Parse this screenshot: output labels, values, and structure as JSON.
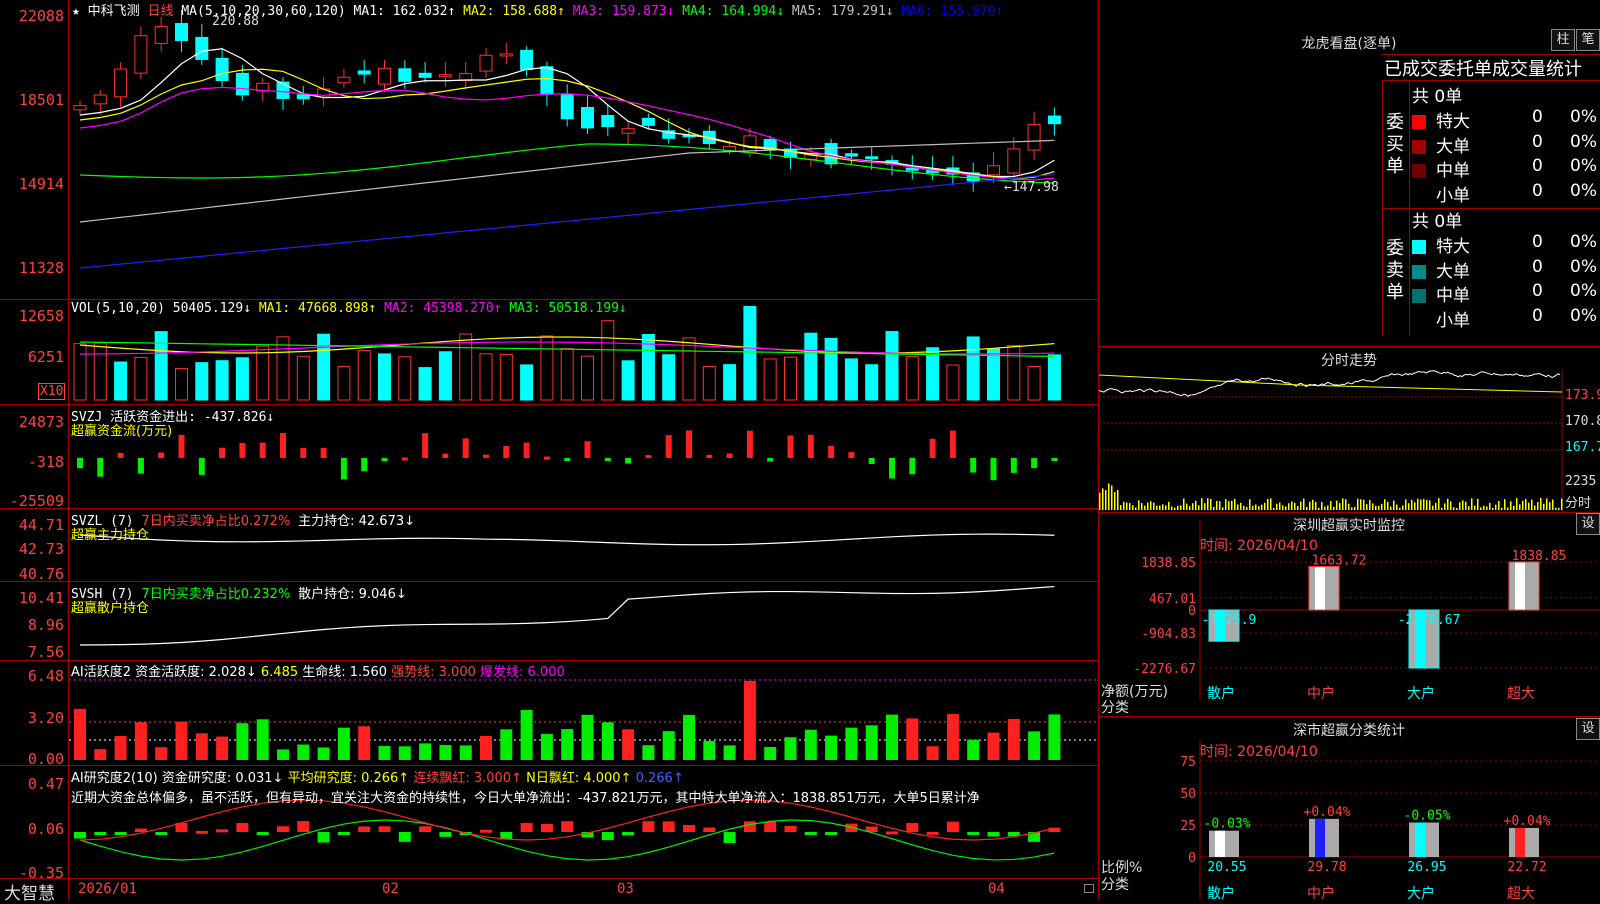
{
  "stock": {
    "star": "★",
    "name": "中科飞测",
    "period": "日线"
  },
  "main_chart": {
    "ma_params": "MA(5,10,20,30,60,120)",
    "ma_items": [
      {
        "text": "MA1: 162.032↑",
        "color": "#ffffff"
      },
      {
        "text": "MA2: 158.688↑",
        "color": "#ffff00"
      },
      {
        "text": "MA3: 159.873↓",
        "color": "#ff00ff"
      },
      {
        "text": "MA4: 164.994↓",
        "color": "#00ff00"
      },
      {
        "text": "MA5: 179.291↓",
        "color": "#c0c0c0"
      },
      {
        "text": "MA6: 155.970↑",
        "color": "#0000ff"
      }
    ],
    "y_labels": [
      "22088",
      "18501",
      "14914",
      "11328"
    ],
    "high_marker": "220.88",
    "low_marker": "←147.98"
  },
  "vol": {
    "title": "VOL(5,10,20)",
    "value": "50405.129↓",
    "ma1": "MA1: 47668.898↑",
    "ma2": "MA2: 45398.270↑",
    "ma3": "MA3: 50518.199↓",
    "y_labels": [
      "12658",
      "6251"
    ],
    "unit": "X10"
  },
  "svzj": {
    "title": "SVZJ  活跃资金进出: -437.826↓",
    "subtitle": "超赢资金流(万元)",
    "y_labels": [
      "24873",
      "-318",
      "-25509"
    ]
  },
  "svzl": {
    "title": "SVZL (7)",
    "ratio": "7日内买卖净占比0.272%",
    "hold": "主力持仓: 42.673↓",
    "subtitle": "超赢主力持仓",
    "y_labels": [
      "44.71",
      "42.73",
      "40.76"
    ]
  },
  "svsh": {
    "title": "SVSH (7)",
    "ratio": "7日内买卖净占比0.232%",
    "hold": "散户持仓: 9.046↓",
    "subtitle": "超赢散户持仓",
    "y_labels": [
      "10.41",
      "8.96",
      "7.56"
    ]
  },
  "ai_active": {
    "title": "AI活跃度2 资金活跃度: 2.028↓",
    "v2": "6.485",
    "life": "生命线: 1.560",
    "strong": "强势线: 3.000",
    "burst": "爆发线: 6.000",
    "y_labels": [
      "6.48",
      "3.20",
      "0.00"
    ]
  },
  "ai_research": {
    "title": "AI研究度2(10) 资金研究度: 0.031↓",
    "avg": "平均研究度: 0.266↑",
    "cont": "连续飘红: 3.000↑",
    "nday": "N日飘红: 4.000↑",
    "last": "0.266↑",
    "comment": "近期大资金总体偏多，虽不活跃，但有异动，宜关注大资金的持续性，今日大单净流出：-437.821万元，其中特大单净流入：1838.851万元，大单5日累计净",
    "y_labels": [
      "0.47",
      "0.06",
      "-0.35"
    ]
  },
  "footer": {
    "brand": "大智慧",
    "dates": [
      "2026/01",
      "02",
      "03",
      "04"
    ]
  },
  "dragon": {
    "title": "龙虎看盘(逐单)",
    "btn_bar": "柱",
    "btn_pen": "笔",
    "tabs": [
      "已成交委托单",
      "成交量统计"
    ],
    "buy_label": "委买单",
    "sell_label": "委卖单",
    "buy_total": "共 0单",
    "sell_total": "共 0单",
    "buy_rows": [
      {
        "name": "特大",
        "count": "0",
        "pct": "0%",
        "color": "#ff0000"
      },
      {
        "name": "大单",
        "count": "0",
        "pct": "0%",
        "color": "#a00000"
      },
      {
        "name": "中单",
        "count": "0",
        "pct": "0%",
        "color": "#700000"
      },
      {
        "name": "小单",
        "count": "0",
        "pct": "0%",
        "color": "#000000"
      }
    ],
    "sell_rows": [
      {
        "name": "特大",
        "count": "0",
        "pct": "0%",
        "color": "#00ffff"
      },
      {
        "name": "大单",
        "count": "0",
        "pct": "0%",
        "color": "#008b8b"
      },
      {
        "name": "中单",
        "count": "0",
        "pct": "0%",
        "color": "#007070"
      },
      {
        "name": "小单",
        "count": "0",
        "pct": "0%",
        "color": "#000000"
      }
    ]
  },
  "intraday": {
    "title": "分时走势",
    "price_labels": [
      "173.9",
      "170.8",
      "167.7"
    ],
    "vol_label": "2235",
    "vol_unit": "分时"
  },
  "sz_monitor": {
    "title": "深圳超赢实时监控",
    "btn": "设",
    "time": "时间: 2026/04/10",
    "y_labels": [
      "1838.85",
      "467.01",
      "0",
      "-904.83",
      "-2276.67"
    ],
    "axis_label": "净额(万元)",
    "axis_sub": "分类",
    "bars": [
      {
        "cat": "散户",
        "value": -1225.9,
        "label": "-1225.9"
      },
      {
        "cat": "中户",
        "value": 1663.72,
        "label": "1663.72"
      },
      {
        "cat": "大户",
        "value": -2276.67,
        "label": "-2276.67"
      },
      {
        "cat": "超大",
        "value": 1838.85,
        "label": "1838.85"
      }
    ]
  },
  "sz_class": {
    "title": "深市超赢分类统计",
    "btn": "设",
    "time": "时间: 2026/04/10",
    "y_labels": [
      "75",
      "50",
      "25",
      "0"
    ],
    "axis_label": "比例%",
    "axis_sub": "分类",
    "bars": [
      {
        "cat": "散户",
        "value": 20.55,
        "label": "20.55",
        "change": "-0.03%",
        "color": "#ffffff",
        "cchg": "#00ff00"
      },
      {
        "cat": "中户",
        "value": 29.78,
        "label": "29.78",
        "change": "+0.04%",
        "color": "#2020ff",
        "cchg": "#ff4040"
      },
      {
        "cat": "大户",
        "value": 26.95,
        "label": "26.95",
        "change": "-0.05%",
        "color": "#00ffff",
        "cchg": "#00ff00"
      },
      {
        "cat": "超大",
        "value": 22.72,
        "label": "22.72",
        "change": "+0.04%",
        "color": "#ff2020",
        "cchg": "#ff4040"
      }
    ]
  }
}
